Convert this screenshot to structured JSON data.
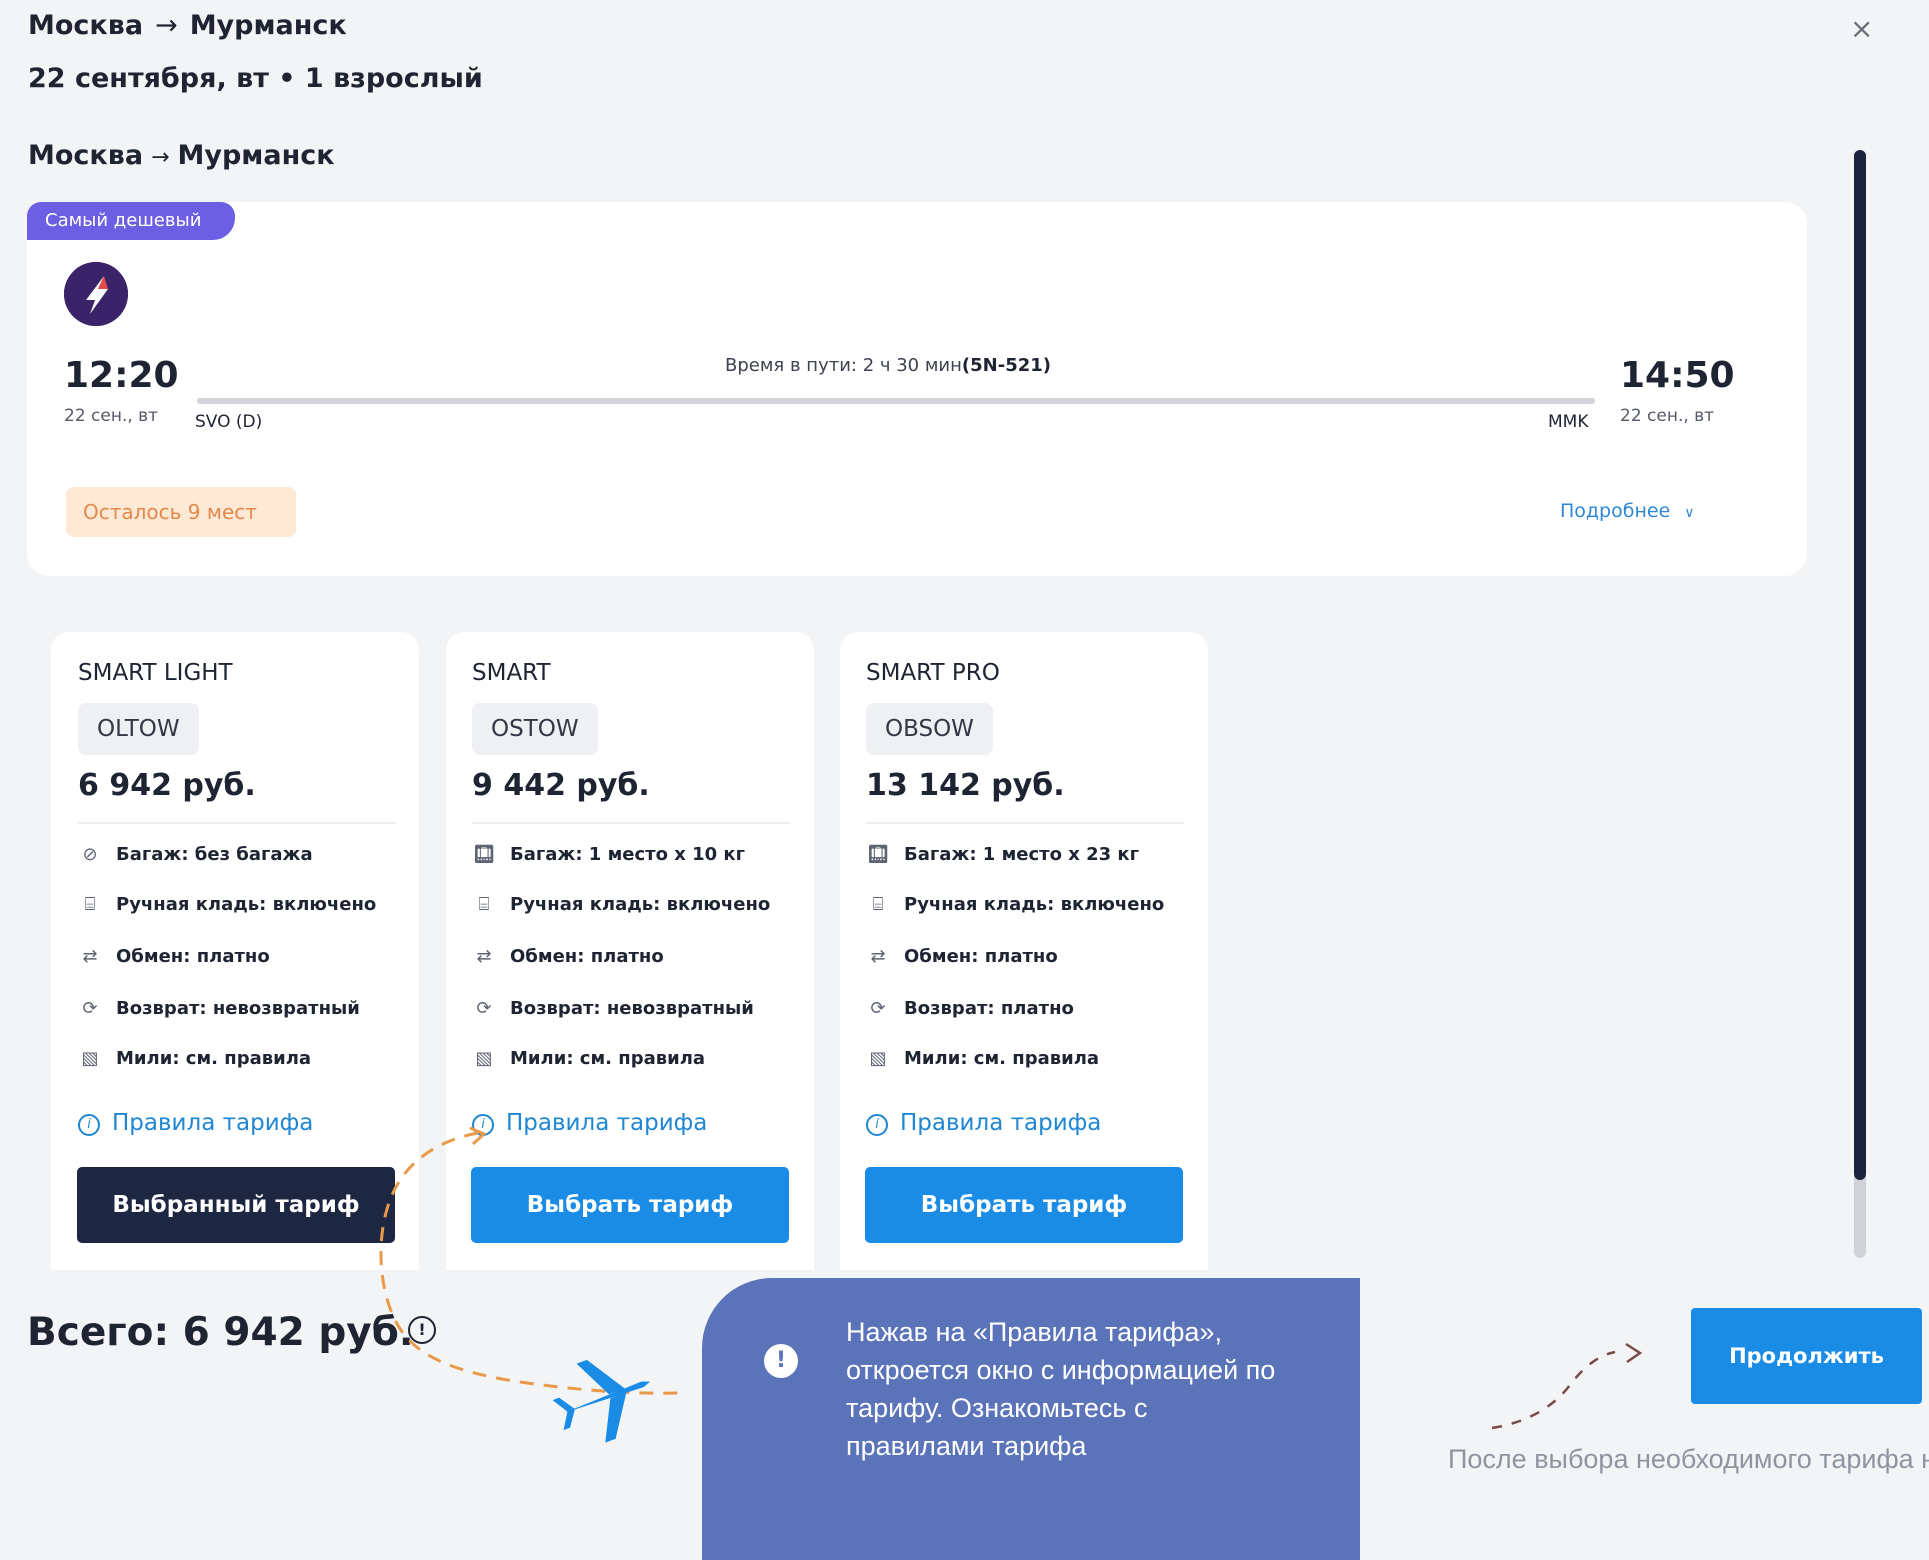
{
  "header": {
    "from": "Москва",
    "to": "Мурманск",
    "arrow": "→",
    "subtitle": "22 сентября, вт • 1 взрослый",
    "close": "×"
  },
  "segment": {
    "from": "Москва",
    "to": "Мурманск",
    "arrow": "→"
  },
  "flight": {
    "badge": "Самый дешевый",
    "airline_icon": "airline-logo-icon",
    "departure": {
      "time": "12:20",
      "date": "22 сен., вт",
      "airport": "SVO (D)"
    },
    "arrival": {
      "time": "14:50",
      "date": "22 сен., вт",
      "airport": "MMK"
    },
    "duration_label": "Время в пути: 2 ч 30 мин",
    "flight_number": "(5N-521)",
    "seats_left": "Осталось 9 мест",
    "details": "Подробнее"
  },
  "tariffs": [
    {
      "name": "SMART LIGHT",
      "code": "OLTOW",
      "price": "6 942 руб.",
      "features": [
        "Багаж: без багажа",
        "Ручная кладь: включено",
        "Обмен: платно",
        "Возврат: невозвратный",
        "Мили: см. правила"
      ],
      "rules": "Правила тарифа",
      "button": "Выбранный тариф",
      "selected": true
    },
    {
      "name": "SMART",
      "code": "OSTOW",
      "price": "9 442 руб.",
      "features": [
        "Багаж: 1 место х 10 кг",
        "Ручная кладь: включено",
        "Обмен: платно",
        "Возврат: невозвратный",
        "Мили: см. правила"
      ],
      "rules": "Правила тарифа",
      "button": "Выбрать тариф",
      "selected": false
    },
    {
      "name": "SMART PRO",
      "code": "OBSOW",
      "price": "13 142 руб.",
      "features": [
        "Багаж: 1 место х 23 кг",
        "Ручная кладь: включено",
        "Обмен: платно",
        "Возврат: платно",
        "Мили: см. правила"
      ],
      "rules": "Правила тарифа",
      "button": "Выбрать тариф",
      "selected": false
    }
  ],
  "footer": {
    "total": "Всего: 6 942 руб.",
    "continue": "Продолжить",
    "note": "После выбора необходимого тарифа нажмите «Продолжить», чтобы перейти к следующему шагу бронирования"
  },
  "tooltip": {
    "icon": "!",
    "text": "Нажав на «Правила тарифа», откроется окно с информацией по тарифу. Ознакомьтесь с правилами тарифа"
  },
  "colors": {
    "accent": "#1a8ce6",
    "selected_button": "#1e2742",
    "badge": "#6c5fe4",
    "tooltip_bg": "#5b74b9",
    "seats_bg": "#fde9d6",
    "seats_text": "#e3894a",
    "plane": "#1a8ce6",
    "dash_orange": "#e89a4a"
  }
}
